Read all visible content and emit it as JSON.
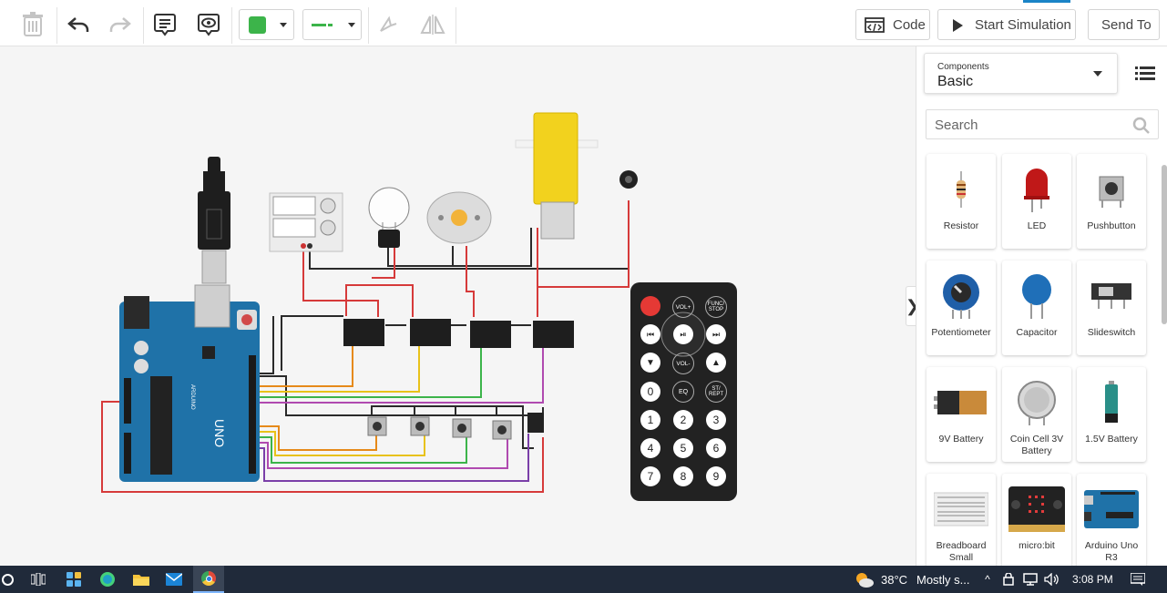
{
  "toolbar": {
    "code_label": "Code",
    "start_label": "Start Simulation",
    "send_label": "Send To",
    "fill_color": "#3cb44a",
    "wire_color": "#3cb44a"
  },
  "sidebar": {
    "components_label": "Components",
    "components_value": "Basic",
    "search_placeholder": "Search",
    "tiles": [
      {
        "label": "Resistor"
      },
      {
        "label": "LED"
      },
      {
        "label": "Pushbutton"
      },
      {
        "label": "Potentiometer"
      },
      {
        "label": "Capacitor"
      },
      {
        "label": "Slideswitch"
      },
      {
        "label": "9V Battery"
      },
      {
        "label": "Coin Cell 3V Battery"
      },
      {
        "label": "1.5V Battery"
      },
      {
        "label": "Breadboard Small"
      },
      {
        "label": "micro:bit"
      },
      {
        "label": "Arduino Uno R3"
      }
    ]
  },
  "remote": {
    "keys": [
      "VOL+",
      "FUNC/ STOP",
      "VOL-",
      "EQ",
      "ST/ REPT",
      "0",
      "1",
      "2",
      "3",
      "4",
      "5",
      "6",
      "7",
      "8",
      "9"
    ]
  },
  "arduino": {
    "brand": "ARDUINO",
    "model": "UNO"
  },
  "taskbar": {
    "temperature": "38°C",
    "weather": "Mostly s...",
    "time": "3:08 PM"
  }
}
